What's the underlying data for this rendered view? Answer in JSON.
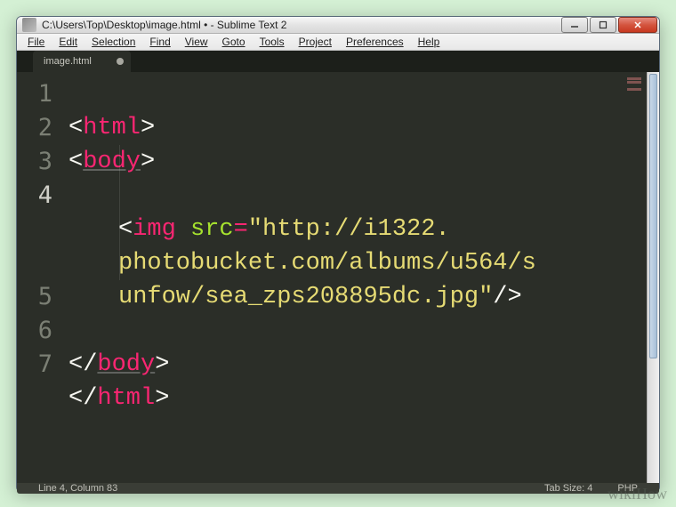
{
  "window": {
    "title": "C:\\Users\\Top\\Desktop\\image.html • - Sublime Text 2"
  },
  "menu": {
    "items": [
      "File",
      "Edit",
      "Selection",
      "Find",
      "View",
      "Goto",
      "Tools",
      "Project",
      "Preferences",
      "Help"
    ]
  },
  "tab": {
    "label": "image.html",
    "dirty": true
  },
  "code": {
    "lines": {
      "l1": {
        "open": "<",
        "tag": "html",
        "close": ">"
      },
      "l2": {
        "open": "<",
        "tag": "body",
        "close": ">"
      },
      "l4": {
        "open": "<",
        "tag": "img",
        "attr": "src",
        "eq": "=",
        "q": "\"",
        "str1": "http://i1322.",
        "str2": "photobucket.com/albums/u564/s",
        "str3": "unfow/sea_zps208895dc.jpg",
        "selfclose": "/>"
      },
      "l6": {
        "open": "</",
        "tag": "body",
        "close": ">"
      },
      "l7": {
        "open": "</",
        "tag": "html",
        "close": ">"
      }
    },
    "gutter": [
      "1",
      "2",
      "3",
      "4",
      "5",
      "6",
      "7"
    ]
  },
  "status": {
    "left": "Line 4, Column 83",
    "tabsize": "Tab Size: 4",
    "lang": "PHP"
  },
  "watermark": "wikiHow"
}
